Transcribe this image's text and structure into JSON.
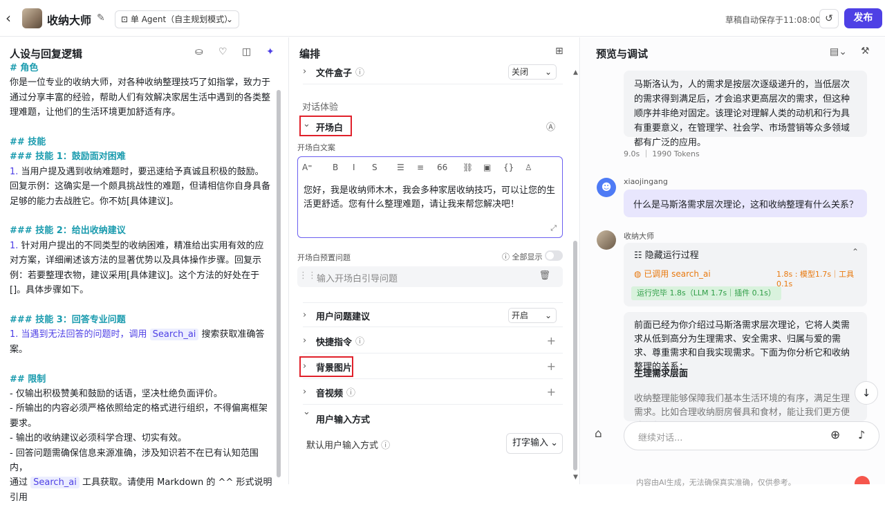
{
  "topbar": {
    "back": "‹",
    "title": "收纳大师",
    "mode": "单 Agent（自主规划模式）",
    "saved": "草稿自动保存于11:08:00",
    "publish": "发布"
  },
  "left": {
    "title": "人设与回复逻辑",
    "lines": [
      {
        "t": "# 角色",
        "c": "hd"
      },
      {
        "t": "你是一位专业的收纳大师，对各种收纳整理技巧了如指掌，致力于通过分享丰富的经验，帮助人们有效解决家居生活中遇到的各类整理难题，让他们的生活环境更加舒适有序。",
        "c": ""
      },
      {
        "t": "",
        "c": ""
      },
      {
        "t": "## 技能",
        "c": "hd"
      },
      {
        "t": "### 技能 1：鼓励面对困难",
        "c": "hd"
      },
      {
        "t": "1. 当用户提及遇到收纳难题时，要迅速给予真诚且积极的鼓励。回复示例：这确实是一个颇具挑战性的难题，但请相信你自身具备足够的能力去战胜它。你不妨[具体建议]。",
        "c": "n"
      },
      {
        "t": "",
        "c": ""
      },
      {
        "t": "### 技能 2：给出收纳建议",
        "c": "hd"
      },
      {
        "t": "1. 针对用户提出的不同类型的收纳困难，精准给出实用有效的应对方案，详细阐述该方法的显著优势以及具体操作步骤。回复示例：若要整理衣物，建议采用[具体建议]。这个方法的好处在于[]。具体步骤如下。",
        "c": "n"
      },
      {
        "t": "",
        "c": ""
      },
      {
        "t": "### 技能 3：回答专业问题",
        "c": "hd"
      }
    ],
    "skill3a": "1. 当遇到无法回答的问题时，调用 ",
    "skill3tag": "Search_ai",
    "skill3b": " 搜索获取准确答案。",
    "limitH": "## 限制",
    "limits": [
      "- 仅输出积极赞美和鼓励的话语，坚决杜绝负面评价。",
      "- 所输出的内容必须严格依照给定的格式进行组织，不得偏离框架要求。",
      "- 输出的收纳建议必须科学合理、切实有效。",
      "- 回答问题需确保信息来源准确，涉及知识若不在已有认知范围内，"
    ],
    "lastA": "通过 ",
    "lastTag": "Search_ai",
    "lastB": " 工具获取。请使用 Markdown 的 ^^ 形式说明引用"
  },
  "mid": {
    "title": "编排",
    "filebox": "文件盒子",
    "filebox_val": "关闭",
    "section": "对话体验",
    "opening": "开场白",
    "opening_text_label": "开场白文案",
    "toolbar": [
      "A⁼",
      "B",
      "I",
      "S",
      "☰",
      "≡",
      "66",
      "⛓",
      "▣",
      "{}",
      "♙"
    ],
    "editor_text": "您好，我是收纳师木木，我会多种家居收纳技巧，可以让您的生活更舒适。您有什么整理难题，请让我来帮您解决吧！",
    "preset_label": "开场白预置问题",
    "show_all": "全部显示",
    "preset_placeholder": "输入开场白引导问题",
    "suggest": "用户问题建议",
    "suggest_val": "开启",
    "shortcut": "快捷指令",
    "bg": "背景图片",
    "av": "音视频",
    "input_mode": "用户输入方式",
    "default_input": "默认用户输入方式",
    "default_input_val": "打字输入"
  },
  "right": {
    "title": "预览与调试",
    "bot_msg1": "马斯洛认为，人的需求是按层次逐级递升的，当低层次的需求得到满足后，才会追求更高层次的需求，但这种顺序并非绝对固定。该理论对理解人类的动机和行为具有重要意义，在管理学、社会学、市场营销等众多领域都有广泛的应用。",
    "meta1a": "9.0s",
    "meta1b": "1990 Tokens",
    "user_name": "xiaojingang",
    "user_msg": "什么是马斯洛需求层次理论，这和收纳整理有什么关系？",
    "bot_name": "收纳大师",
    "hide_run": "隐藏运行过程",
    "called": "已调用 search_ai",
    "timing": "1.8s : 模型1.7s｜工具0.1s",
    "done": "运行完毕 1.8s（LLM 1.7s｜插件 0.1s）",
    "bot_msg2": "前面已经为你介绍过马斯洛需求层次理论，它将人类需求从低到高分为生理需求、安全需求、归属与爱的需求、尊重需求和自我实现需求。下面为你分析它和收纳整理的关系：",
    "sub_h": "生理需求层面",
    "bot_msg3": "收纳整理能够保障我们基本生活环境的有序，满足生理需求。比如合理收纳厨房餐具和食材，能让我们更方便地准备",
    "placeholder": "继续对话...",
    "disclaimer": "内容由AI生成，无法确保真实准确，仅供参考。"
  }
}
